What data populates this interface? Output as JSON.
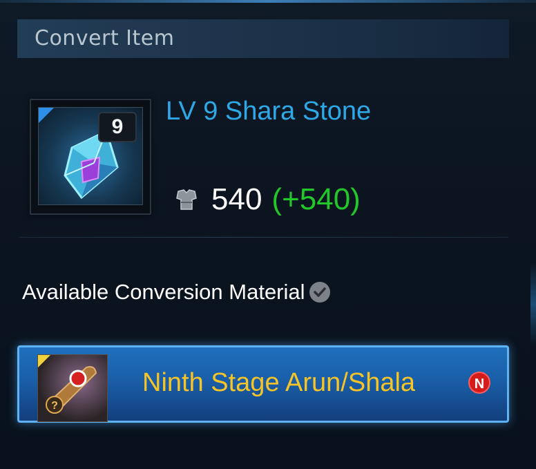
{
  "header": {
    "title": "Convert Item"
  },
  "item": {
    "level_badge": "9",
    "name": "LV 9 Shara Stone",
    "icon": "shara-stone-gem-icon",
    "stat_icon": "armor-icon",
    "stat_value": "540",
    "stat_delta": "(+540)"
  },
  "materials": {
    "label": "Available Conversion Material",
    "info_icon": "check-circle-icon",
    "selected": {
      "name": "Ninth Stage Arun/Shala",
      "icon": "scroll-icon",
      "badge": "N"
    }
  },
  "colors": {
    "item_name": "#2ea8e6",
    "stat_delta": "#22c82a",
    "material_name": "#f5c528",
    "button_bg": "#1a5ea8",
    "button_border": "#5fb3f4",
    "new_badge": "#d41c1c"
  }
}
